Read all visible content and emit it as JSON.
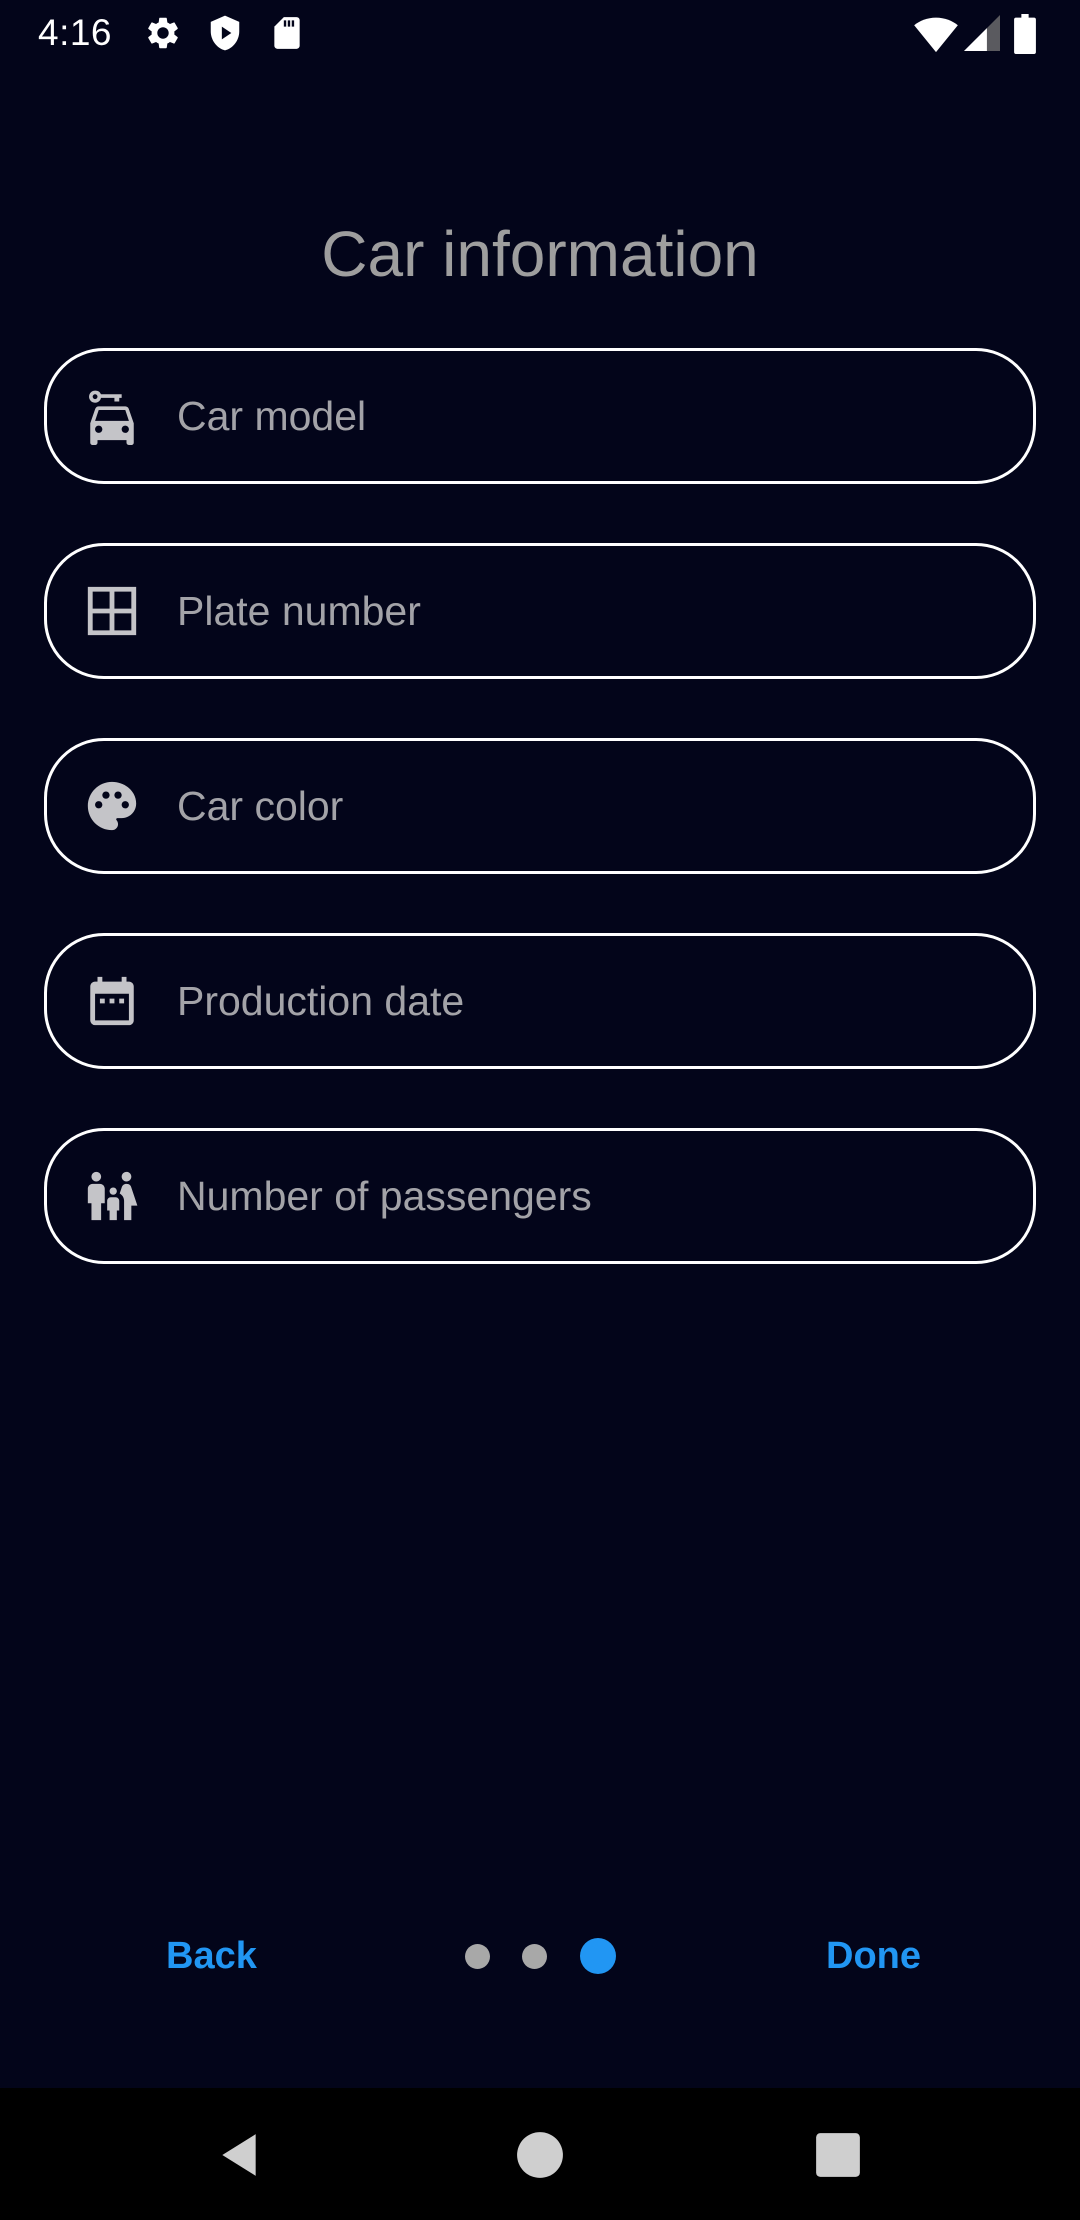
{
  "status_bar": {
    "time": "4:16",
    "left_icons": [
      "settings-icon",
      "shield-play-icon",
      "sd-card-icon"
    ],
    "right_icons": [
      "wifi-icon",
      "cell-signal-icon",
      "battery-icon"
    ]
  },
  "page": {
    "title": "Car information"
  },
  "form": {
    "fields": [
      {
        "icon": "car-key-icon",
        "placeholder": "Car model",
        "value": ""
      },
      {
        "icon": "grid-icon",
        "placeholder": "Plate number",
        "value": ""
      },
      {
        "icon": "palette-icon",
        "placeholder": "Car color",
        "value": ""
      },
      {
        "icon": "calendar-icon",
        "placeholder": "Production date",
        "value": ""
      },
      {
        "icon": "family-icon",
        "placeholder": "Number of passengers",
        "value": ""
      }
    ]
  },
  "navigation": {
    "back_label": "Back",
    "done_label": "Done",
    "page_count": 3,
    "current_page": 3
  },
  "colors": {
    "background": "#03051a",
    "accent": "#2196f3",
    "field_border": "#ffffff",
    "placeholder": "#a3a3a8",
    "title": "#9e9e9e"
  },
  "system_nav": [
    "back-triangle-icon",
    "home-circle-icon",
    "recents-square-icon"
  ]
}
